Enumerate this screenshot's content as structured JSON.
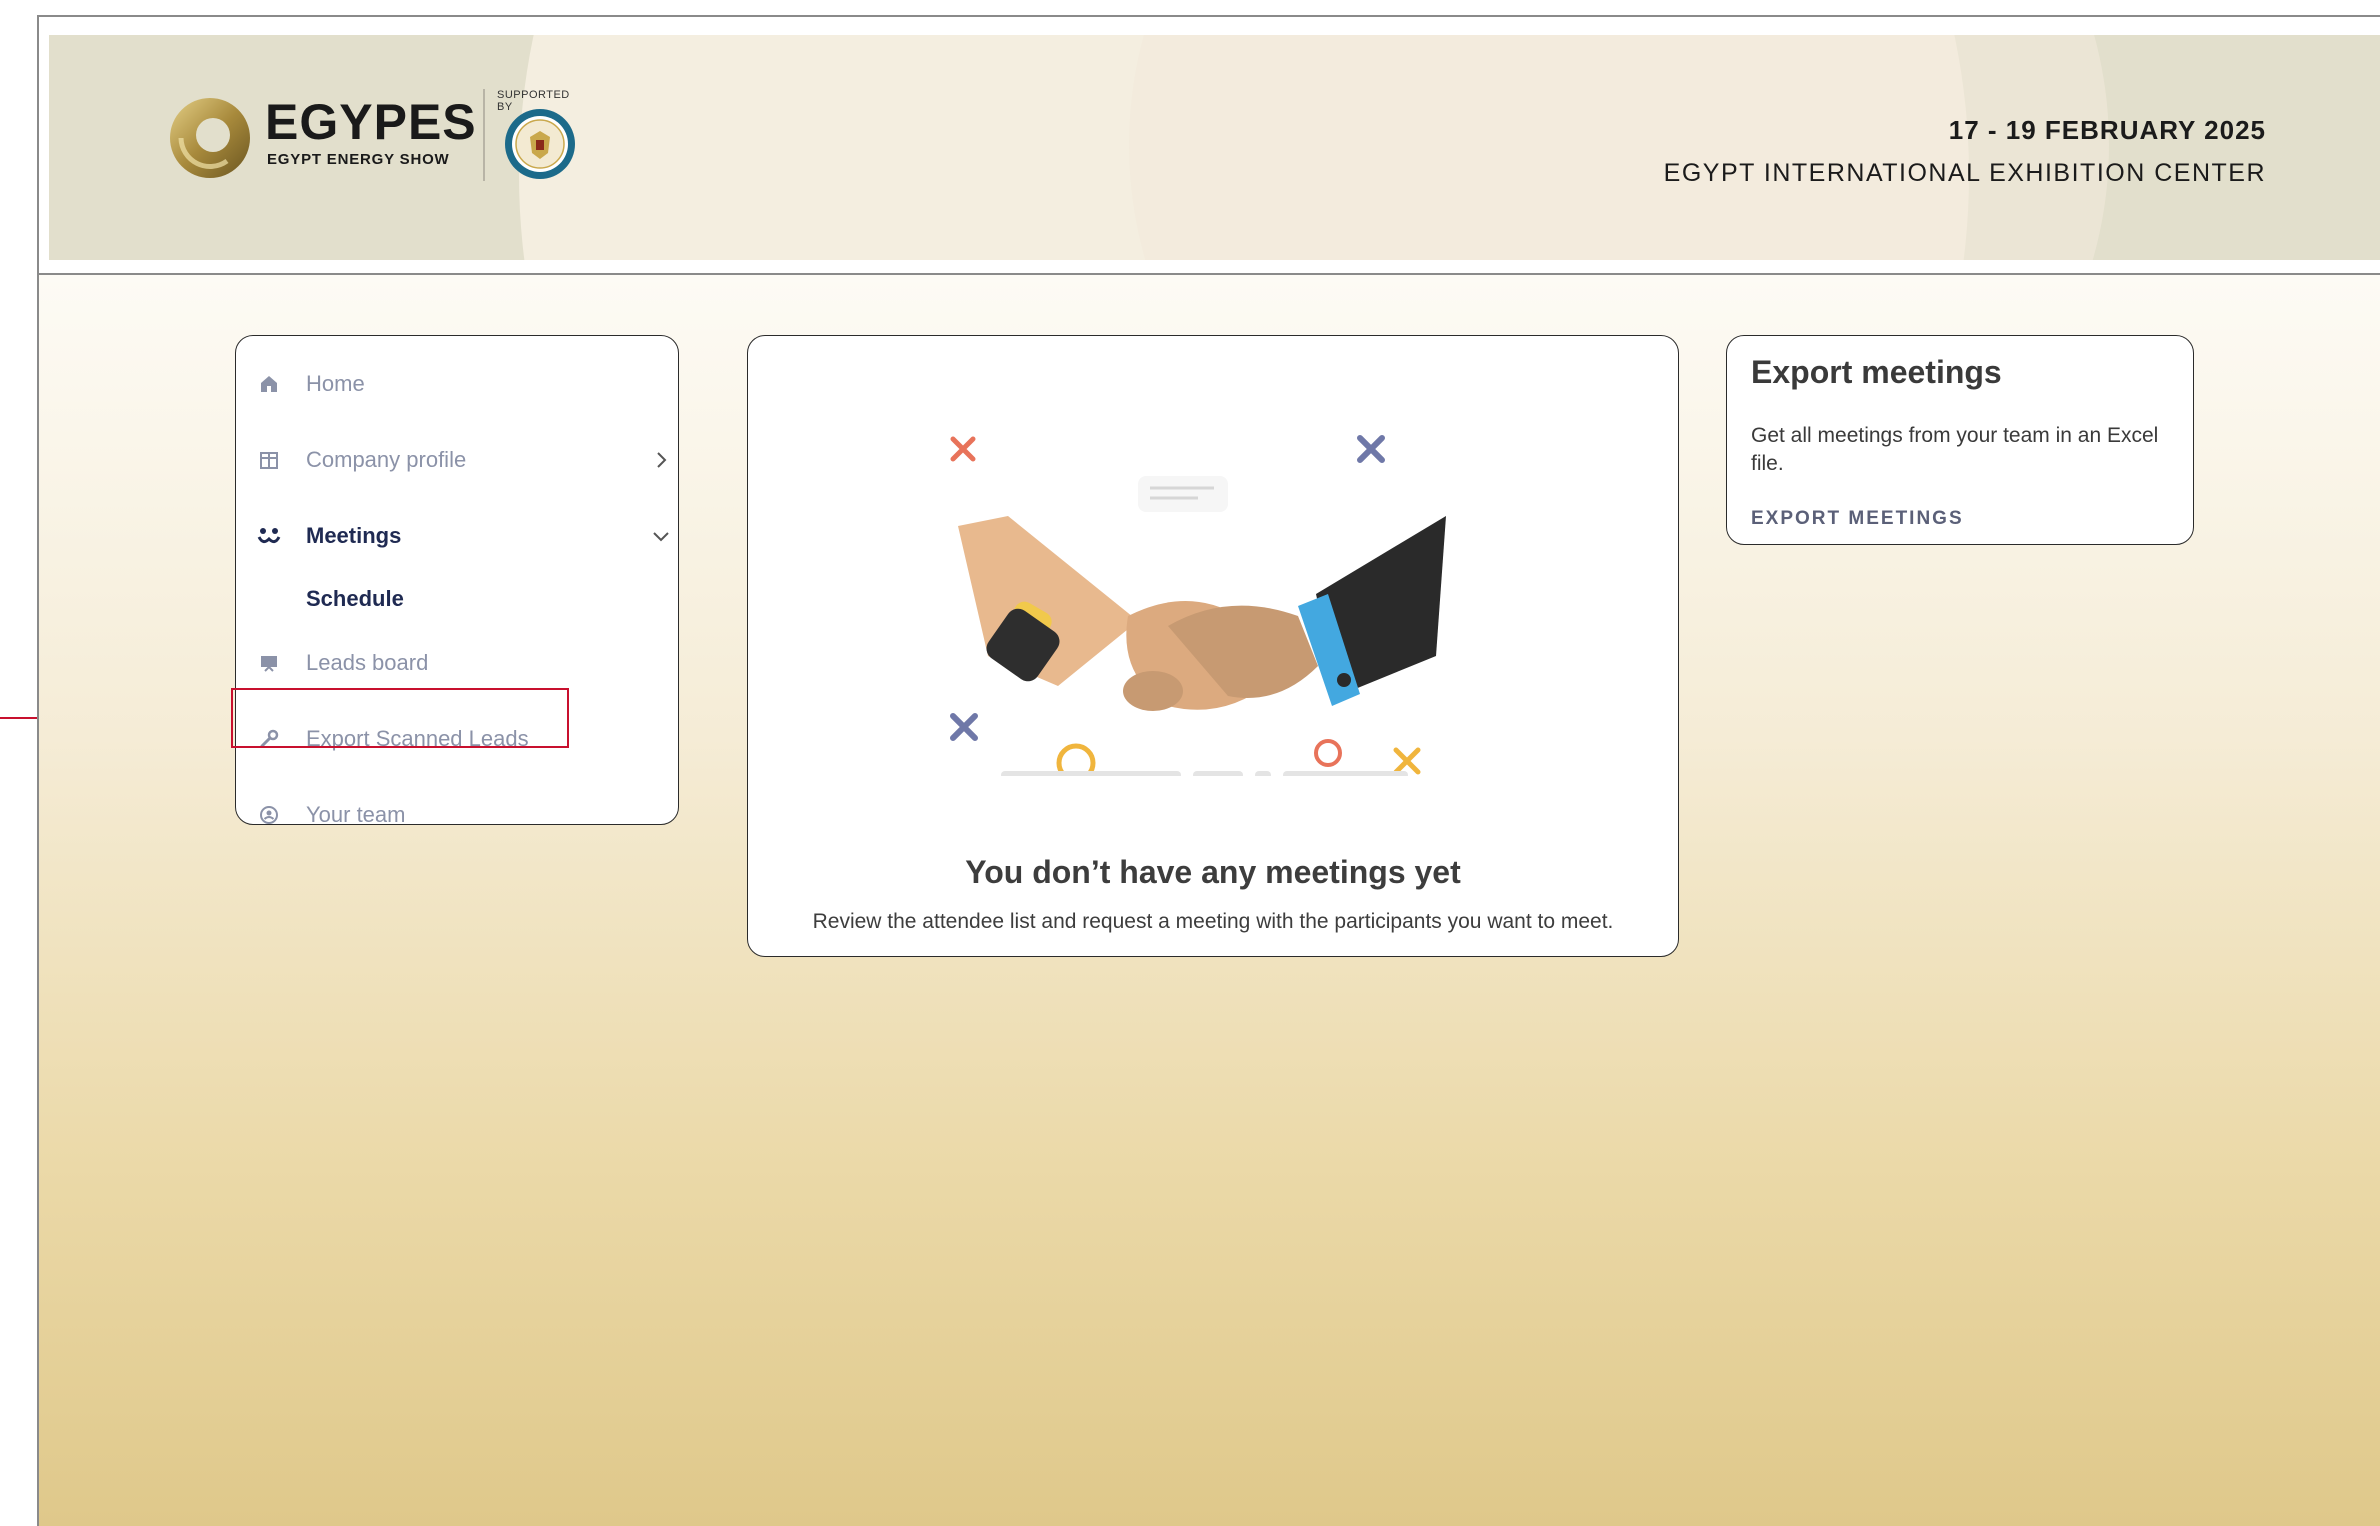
{
  "header": {
    "logo": {
      "brand": "EGYPES",
      "tagline": "EGYPT ENERGY SHOW",
      "supported_by": "SUPPORTED BY"
    },
    "event_dates": "17 - 19 FEBRUARY 2025",
    "venue": "EGYPT INTERNATIONAL EXHIBITION CENTER"
  },
  "sidebar": {
    "items": [
      {
        "label": "Home",
        "icon": "home-icon"
      },
      {
        "label": "Company profile",
        "icon": "building-icon"
      },
      {
        "label": "Meetings",
        "icon": "people-icon"
      },
      {
        "label": "Schedule"
      },
      {
        "label": "Leads board",
        "icon": "board-icon"
      },
      {
        "label": "Export Scanned Leads",
        "icon": "wrench-icon"
      },
      {
        "label": "Your team",
        "icon": "team-icon"
      }
    ]
  },
  "empty_state": {
    "title": "You don’t have any meetings yet",
    "subtitle": "Review the attendee list and request a meeting with the participants you want to meet."
  },
  "export_card": {
    "title": "Export meetings",
    "description": "Get all meetings from your team in an Excel file.",
    "link": "EXPORT MEETINGS"
  },
  "colors": {
    "nav_inactive": "#8b92a8",
    "nav_active": "#1f2a52",
    "highlight": "#c8102e",
    "logo_gold": "#c9a84c"
  }
}
